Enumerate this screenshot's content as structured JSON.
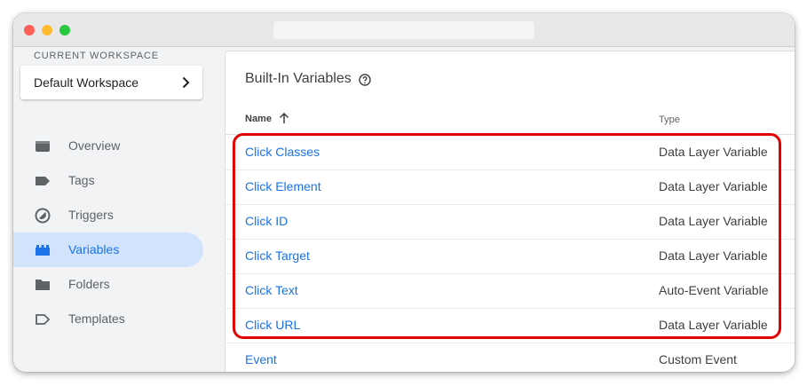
{
  "sidebar": {
    "workspace_label": "CURRENT WORKSPACE",
    "workspace_name": "Default Workspace",
    "items": [
      {
        "label": "Overview",
        "icon": "overview-icon"
      },
      {
        "label": "Tags",
        "icon": "tag-icon"
      },
      {
        "label": "Triggers",
        "icon": "trigger-icon"
      },
      {
        "label": "Variables",
        "icon": "variables-icon",
        "active": true
      },
      {
        "label": "Folders",
        "icon": "folder-icon"
      },
      {
        "label": "Templates",
        "icon": "template-icon"
      }
    ]
  },
  "main": {
    "title": "Built-In Variables",
    "columns": {
      "name": "Name",
      "type": "Type"
    },
    "rows": [
      {
        "name": "Click Classes",
        "type": "Data Layer Variable"
      },
      {
        "name": "Click Element",
        "type": "Data Layer Variable"
      },
      {
        "name": "Click ID",
        "type": "Data Layer Variable"
      },
      {
        "name": "Click Target",
        "type": "Data Layer Variable"
      },
      {
        "name": "Click Text",
        "type": "Auto-Event Variable"
      },
      {
        "name": "Click URL",
        "type": "Data Layer Variable"
      },
      {
        "name": "Event",
        "type": "Custom Event"
      }
    ]
  },
  "colors": {
    "accent": "#1a73e8",
    "active_nav_bg": "#d2e3fc",
    "highlight_border": "#e00000"
  }
}
